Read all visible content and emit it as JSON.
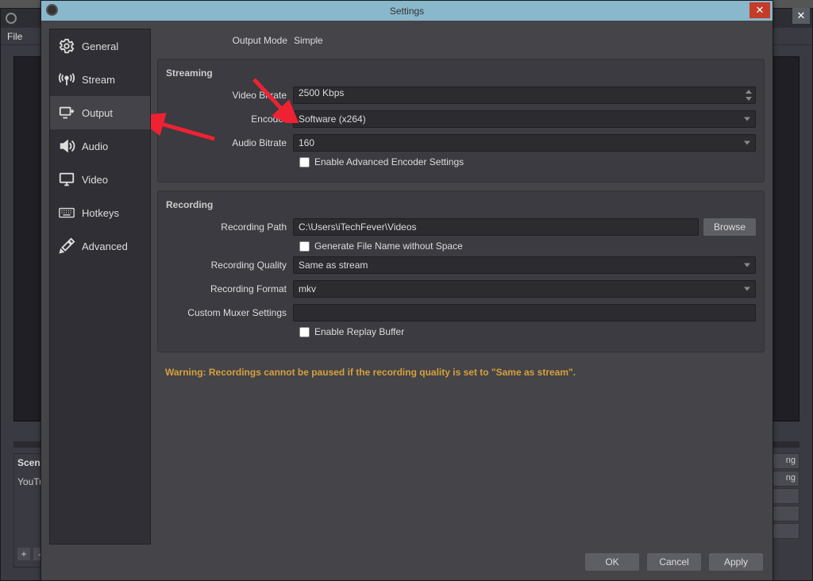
{
  "bg": {
    "menu_file": "File",
    "scene_header": "Scene",
    "scene_item": "YouTu",
    "right_suffix": "ng"
  },
  "dialog": {
    "title": "Settings",
    "sidebar": {
      "items": [
        {
          "label": "General"
        },
        {
          "label": "Stream"
        },
        {
          "label": "Output"
        },
        {
          "label": "Audio"
        },
        {
          "label": "Video"
        },
        {
          "label": "Hotkeys"
        },
        {
          "label": "Advanced"
        }
      ]
    },
    "output_mode": {
      "label": "Output Mode",
      "value": "Simple"
    },
    "streaming": {
      "title": "Streaming",
      "video_bitrate": {
        "label": "Video Bitrate",
        "value": "2500 Kbps"
      },
      "encoder": {
        "label": "Encoder",
        "value": "Software (x264)"
      },
      "audio_bitrate": {
        "label": "Audio Bitrate",
        "value": "160"
      },
      "advanced_label": "Enable Advanced Encoder Settings"
    },
    "recording": {
      "title": "Recording",
      "path": {
        "label": "Recording Path",
        "value": "C:\\Users\\iTechFever\\Videos"
      },
      "filename_no_space": "Generate File Name without Space",
      "quality": {
        "label": "Recording Quality",
        "value": "Same as stream"
      },
      "format": {
        "label": "Recording Format",
        "value": "mkv"
      },
      "muxer": {
        "label": "Custom Muxer Settings",
        "value": ""
      },
      "replay_buffer": "Enable Replay Buffer",
      "browse": "Browse"
    },
    "warning": "Warning: Recordings cannot be paused if the recording quality is set to \"Same as stream\".",
    "buttons": {
      "ok": "OK",
      "cancel": "Cancel",
      "apply": "Apply"
    }
  }
}
